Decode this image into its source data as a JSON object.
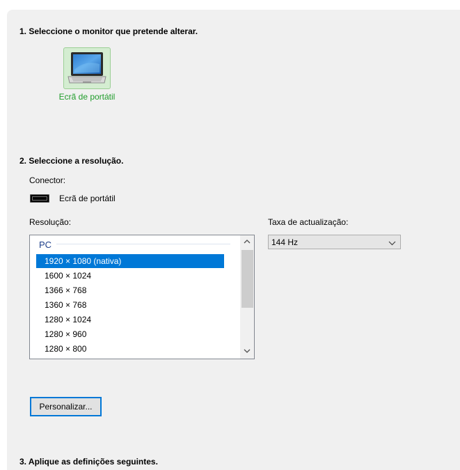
{
  "step1": {
    "heading": "1. Seleccione o monitor que pretende alterar."
  },
  "monitor": {
    "label": "Ecrã de portátil",
    "icon": "laptop-icon"
  },
  "step2": {
    "heading": "2. Seleccione a resolução.",
    "connector_label": "Conector:",
    "connector_value": "Ecrã de portátil",
    "resolution_label": "Resolução:",
    "refresh_label": "Taxa de actualização:"
  },
  "resolutions": {
    "group": "PC",
    "items": [
      "1920 × 1080 (nativa)",
      "1600 × 1024",
      "1366 × 768",
      "1360 × 768",
      "1280 × 1024",
      "1280 × 960",
      "1280 × 800"
    ],
    "selected_index": 0
  },
  "refresh_rate": {
    "value": "144 Hz"
  },
  "custom_button": {
    "label": "Personalizar..."
  },
  "step3": {
    "heading": "3. Aplique as definições seguintes."
  },
  "colors": {
    "selection": "#0078d7",
    "monitor_label": "#1f9c2a",
    "panel_bg": "#f0f0f0"
  }
}
